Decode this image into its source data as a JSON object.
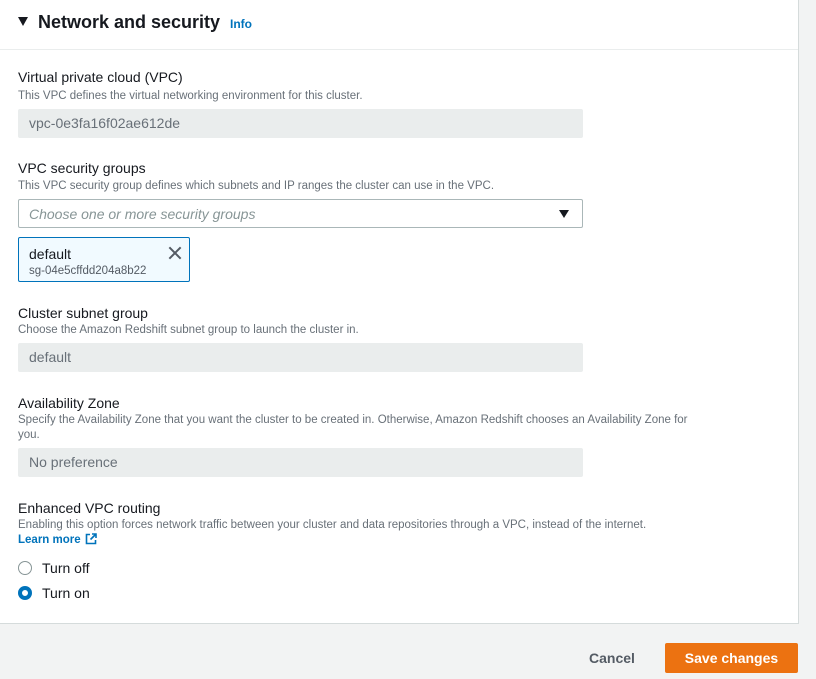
{
  "section": {
    "title": "Network and security",
    "info_link": "Info",
    "caret_icon": "caret-down-icon"
  },
  "vpc": {
    "label": "Virtual private cloud (VPC)",
    "description": "This VPC defines the virtual networking environment for this cluster.",
    "value": "vpc-0e3fa16f02ae612de"
  },
  "security_groups": {
    "label": "VPC security groups",
    "description": "This VPC security group defines which subnets and IP ranges the cluster can use in the VPC.",
    "placeholder": "Choose one or more security groups",
    "selected": [
      {
        "name": "default",
        "id": "sg-04e5cffdd204a8b22"
      }
    ]
  },
  "subnet_group": {
    "label": "Cluster subnet group",
    "description": "Choose the Amazon Redshift subnet group to launch the cluster in.",
    "value": "default"
  },
  "availability_zone": {
    "label": "Availability Zone",
    "description": "Specify the Availability Zone that you want the cluster to be created in. Otherwise, Amazon Redshift chooses an Availability Zone for you.",
    "value": "No preference"
  },
  "enhanced_routing": {
    "label": "Enhanced VPC routing",
    "description": "Enabling this option forces network traffic between your cluster and data repositories through a VPC, instead of the internet.",
    "learn_more": "Learn more",
    "options": [
      {
        "label": "Turn off",
        "checked": false
      },
      {
        "label": "Turn on",
        "checked": true
      }
    ]
  },
  "footer": {
    "cancel_label": "Cancel",
    "save_label": "Save changes"
  },
  "colors": {
    "accent": "#0073bb",
    "primary_button": "#ec7211"
  }
}
